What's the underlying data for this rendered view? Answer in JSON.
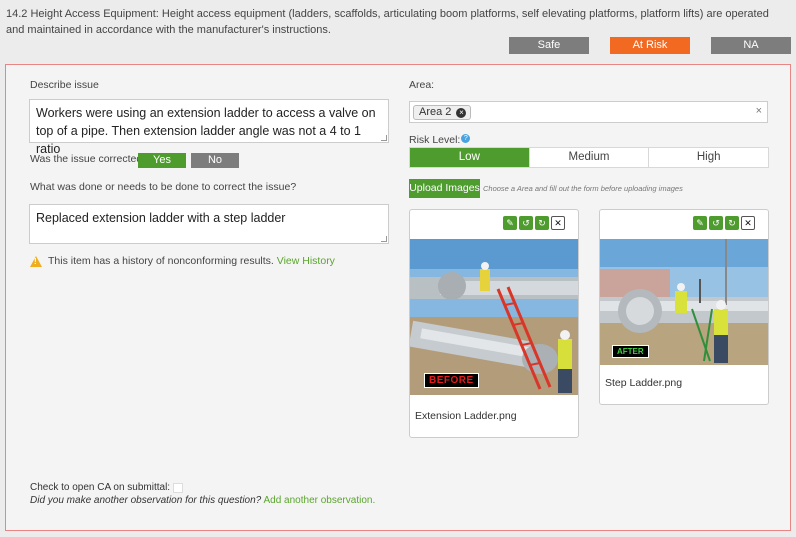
{
  "question": {
    "text": "14.2 Height Access Equipment: Height access equipment (ladders, scaffolds, articulating boom platforms, self elevating platforms, platform lifts) are operated and maintained in accordance with the manufacturer's instructions."
  },
  "status": {
    "safe_label": "Safe",
    "at_risk_label": "At Risk",
    "na_label": "NA",
    "selected": "At Risk"
  },
  "form": {
    "describe_label": "Describe issue",
    "describe_value": "Workers were using an extension ladder to access a valve on top of a pipe. Then extension ladder angle was not a 4 to 1 ratio",
    "corrected_label": "Was the issue corrected?",
    "yes_label": "Yes",
    "no_label": "No",
    "corrected_selected": "Yes",
    "correction_label": "What was done or needs to be done to correct the issue?",
    "correction_value": "Replaced extension ladder with a step ladder",
    "warning_text": "This item has a history of nonconforming results.",
    "view_history_label": "View History",
    "check_ca_label": "Check to open CA on submittal:",
    "another_question": "Did you make another observation for this question?",
    "another_link": "Add another observation."
  },
  "area": {
    "label": "Area:",
    "selected_tag": "Area 2",
    "tag_remove": "×",
    "clear": "×"
  },
  "risk": {
    "label": "Risk Level:",
    "help": "?",
    "options": [
      "Low",
      "Medium",
      "High"
    ],
    "selected": "Low"
  },
  "upload": {
    "button_label": "Upload Images",
    "note": "Choose a Area and fill out the form before uploading images"
  },
  "images": [
    {
      "filename": "Extension Ladder.png",
      "overlay_label": "BEFORE"
    },
    {
      "filename": "Step Ladder.png",
      "overlay_label": "AFTER"
    }
  ],
  "tool_icons": [
    "edit-icon",
    "rotate-left-icon",
    "rotate-right-icon",
    "close-icon"
  ],
  "tool_glyphs": {
    "edit": "✎",
    "rotate_left": "↺",
    "rotate_right": "↻",
    "close": "✕"
  },
  "warning_glyph": "!",
  "colors": {
    "green": "#4e9c2e",
    "orange": "#f26a21",
    "gray": "#7d7d7d",
    "link": "#5aa52d",
    "panel_border": "#e88686"
  }
}
